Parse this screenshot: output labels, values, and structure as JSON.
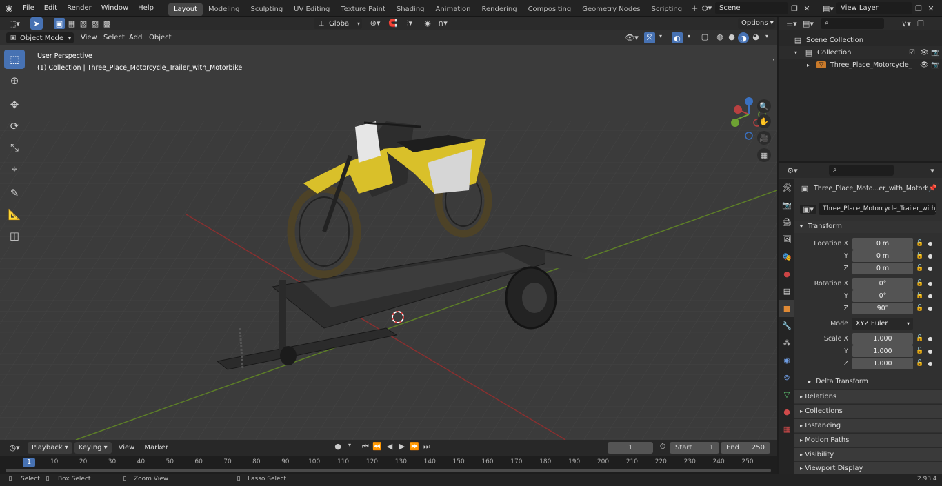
{
  "menu": [
    "File",
    "Edit",
    "Render",
    "Window",
    "Help"
  ],
  "workspaces": [
    "Layout",
    "Modeling",
    "Sculpting",
    "UV Editing",
    "Texture Paint",
    "Shading",
    "Animation",
    "Rendering",
    "Compositing",
    "Geometry Nodes",
    "Scripting"
  ],
  "active_workspace": "Layout",
  "scene": "Scene",
  "view_layer": "View Layer",
  "header": {
    "orientation": "Global",
    "options": "Options"
  },
  "vp_menu": {
    "mode": "Object Mode",
    "view": "View",
    "select": "Select",
    "add": "Add",
    "object": "Object"
  },
  "viewport": {
    "perspective": "User Perspective",
    "collection_info": "(1) Collection | Three_Place_Motorcycle_Trailer_with_Motorbike"
  },
  "outliner": {
    "scene_collection": "Scene Collection",
    "collection": "Collection",
    "object": "Three_Place_Motorcycle_"
  },
  "properties": {
    "object_name": "Three_Place_Moto...er_with_Motorbik",
    "data_name": "Three_Place_Motorcycle_Trailer_with_M...",
    "transform_title": "Transform",
    "location": {
      "label": "Location X",
      "x": "0 m",
      "y": "0 m",
      "z": "0 m"
    },
    "rotation": {
      "label": "Rotation X",
      "x": "0°",
      "y": "0°",
      "z": "90°"
    },
    "mode_label": "Mode",
    "mode": "XYZ Euler",
    "scale": {
      "label": "Scale X",
      "x": "1.000",
      "y": "1.000",
      "z": "1.000"
    },
    "axis_y": "Y",
    "axis_z": "Z",
    "delta": "Delta Transform",
    "panels": [
      "Relations",
      "Collections",
      "Instancing",
      "Motion Paths",
      "Visibility",
      "Viewport Display"
    ]
  },
  "timeline": {
    "playback": "Playback",
    "keying": "Keying",
    "view": "View",
    "marker": "Marker",
    "current": "1",
    "start_label": "Start",
    "start": "1",
    "end_label": "End",
    "end": "250",
    "ticks": [
      "1",
      "10",
      "20",
      "30",
      "40",
      "50",
      "60",
      "70",
      "80",
      "90",
      "100",
      "110",
      "120",
      "130",
      "140",
      "150",
      "160",
      "170",
      "180",
      "190",
      "200",
      "210",
      "220",
      "230",
      "240",
      "250"
    ]
  },
  "status": {
    "select": "Select",
    "box": "Box Select",
    "zoom": "Zoom View",
    "lasso": "Lasso Select",
    "version": "2.93.4"
  },
  "colors": {
    "accent": "#4772b3",
    "bike_yellow": "#d9c02a",
    "x_axis": "#a03030",
    "y_axis": "#6e9a2c"
  }
}
